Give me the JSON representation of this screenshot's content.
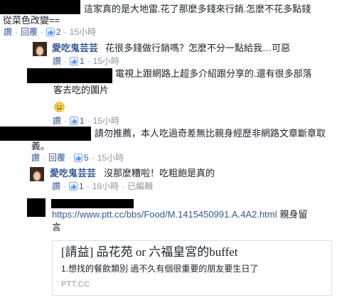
{
  "separator": "·",
  "colors": {
    "text": "#1d2129",
    "link": "#365899",
    "meta": "#90949c",
    "redaction": "#000000",
    "card_border": "#dddfe2",
    "like_icon": "#5890ff",
    "emoji_face": "#f7d046"
  },
  "icons": {
    "like_count": "thumbs-up-icon",
    "emoji": "smiley-emoji-icon"
  },
  "comments": [
    {
      "lines": [
        "這家真的是大地雷.花了那麼多錢來行銷.怎麼不花多點錢",
        "從菜色改變=="
      ],
      "actions": {
        "like": "讚",
        "reply": "回覆",
        "like_count": "2",
        "time": "15小時"
      },
      "replies": [
        {
          "author": "愛吃鬼芸芸",
          "lines": [
            "花很多錢做行銷嗎？怎麼不分一點給我…可惡"
          ],
          "actions": {
            "like": "讚",
            "like_count": "1",
            "time": "15小時"
          }
        },
        {
          "lines": [
            "電視上跟網路上超多介紹跟分享的.還有很多部落",
            "客去吃的圖片"
          ],
          "emoji_icon": "smiley-emoji-icon",
          "actions": {
            "like": "讚",
            "like_count": "1",
            "time": "15小時"
          }
        }
      ]
    },
    {
      "lines": [
        "請勿推薦，本人吃過奇差無比親身經歷非網路文章斷章取",
        "義。"
      ],
      "actions": {
        "like": "讚",
        "reply": "回覆",
        "like_count": "5",
        "time": "15小時"
      },
      "replies": [
        {
          "author": "愛吃鬼芸芸",
          "lines": [
            "沒那麼糟啦！吃粗飽是真的"
          ],
          "actions": {
            "like": "讚",
            "like_count": "1",
            "time": "18小時",
            "edited": "已編輯"
          }
        },
        {
          "link": "https://www.ptt.cc/bbs/Food/M.1415450991.A.4A2.html",
          "lines": [
            "親身留",
            "言"
          ],
          "link_preview": {
            "title": "[請益] 品花苑 or 六福皇宮的buffet",
            "description": "1.想找的餐飲類別 過不久有個很重要的朋友要生日了",
            "domain": "PTT.CC"
          }
        }
      ]
    }
  ]
}
